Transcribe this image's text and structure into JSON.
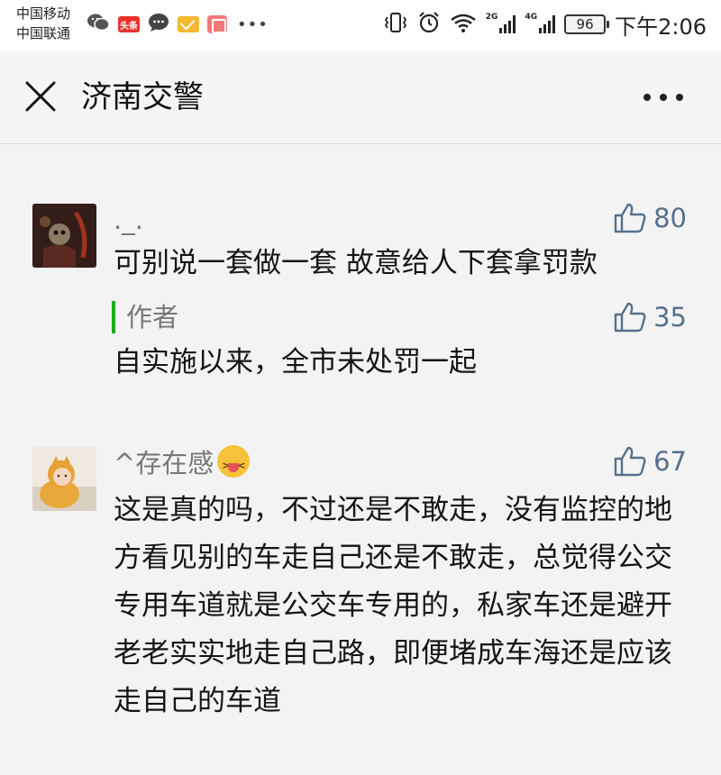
{
  "status_bar": {
    "carrier_1": "中国移动",
    "carrier_2": "中国联通",
    "news_badge": "头条",
    "network_1": "2G",
    "network_2": "4G",
    "battery": "96",
    "time": "下午2:06"
  },
  "header": {
    "title": "济南交警"
  },
  "comments": [
    {
      "nickname": "._.",
      "likes": "80",
      "text": "可别说一套做一套 故意给人下套拿罚款",
      "author_reply": {
        "label": "作者",
        "likes": "35",
        "text": "自实施以来，全市未处罚一起"
      }
    },
    {
      "nickname": "^存在感",
      "likes": "67",
      "text": "这是真的吗，不过还是不敢走，没有监控的地方看见别的车走自己还是不敢走，总觉得公交专用车道就是公交车专用的，私家车还是避开老老实实地走自己路，即便堵成车海还是应该走自己的车道"
    }
  ],
  "colors": {
    "like_blue": "#57708e",
    "author_bar_green": "#1aad19",
    "nickname_gray": "#777777"
  },
  "icons": [
    "wechat-icon",
    "toutiao-icon",
    "message-icon",
    "mail-icon",
    "reader-icon",
    "vibrate-icon",
    "alarm-icon",
    "wifi-icon",
    "signal-icon",
    "battery-icon",
    "close-icon",
    "more-icon",
    "thumbs-up-icon"
  ]
}
